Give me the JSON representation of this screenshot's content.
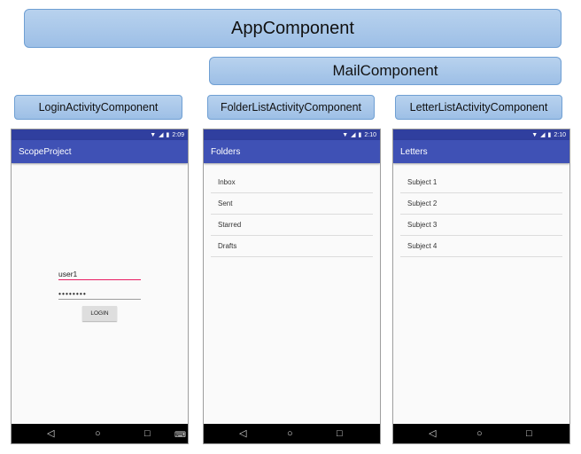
{
  "components": {
    "app": "AppComponent",
    "mail": "MailComponent",
    "login_activity": "LoginActivityComponent",
    "folder_list_activity": "FolderListActivityComponent",
    "letter_list_activity": "LetterListActivityComponent"
  },
  "screens": {
    "login": {
      "time": "2:09",
      "title": "ScopeProject",
      "username": "user1",
      "password": "••••••••",
      "login_button": "LOGIN"
    },
    "folders": {
      "time": "2:10",
      "title": "Folders",
      "items": [
        "Inbox",
        "Sent",
        "Starred",
        "Drafts"
      ]
    },
    "letters": {
      "time": "2:10",
      "title": "Letters",
      "items": [
        "Subject 1",
        "Subject 2",
        "Subject 3",
        "Subject 4"
      ]
    }
  },
  "icons": {
    "wifi": "wifi-icon",
    "signal": "signal-icon",
    "battery": "battery-icon",
    "back": "back-icon",
    "home": "home-icon",
    "recents": "recents-icon",
    "keyboard": "keyboard-icon"
  },
  "colors": {
    "component_box": "#9dbfe6",
    "component_border": "#6f9fd3",
    "status_bar": "#303f9f",
    "toolbar": "#3f51b5",
    "username_underline": "#e91e63"
  }
}
